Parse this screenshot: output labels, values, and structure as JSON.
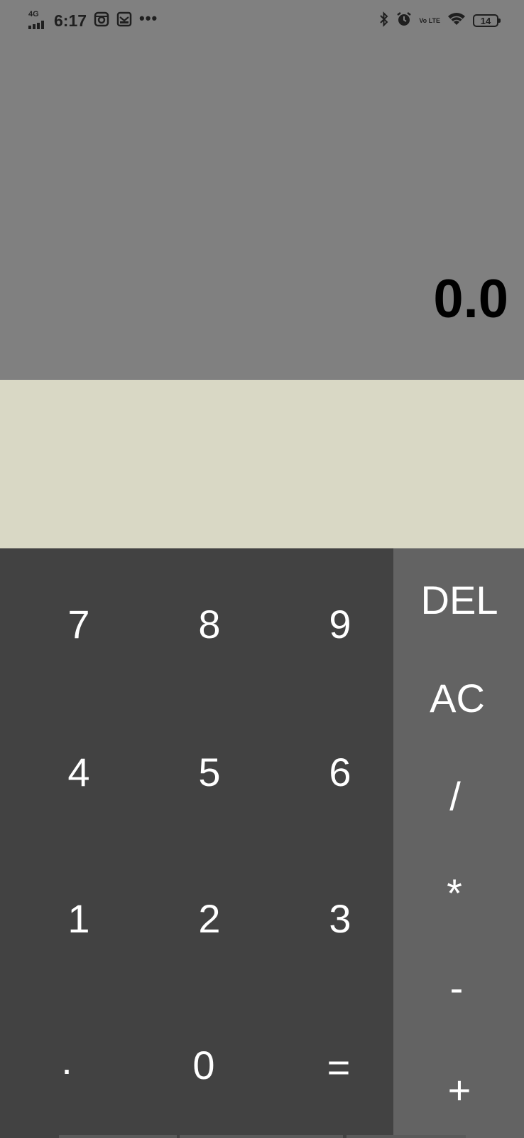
{
  "status_bar": {
    "network": "4G",
    "time": "6:17",
    "more": "•••",
    "volte": "Vo LTE",
    "battery": "14"
  },
  "display": {
    "result": "0.0"
  },
  "keypad": {
    "numbers": [
      "7",
      "8",
      "9",
      "4",
      "5",
      "6",
      "1",
      "2",
      "3",
      ".",
      "0",
      "="
    ],
    "operators": [
      "DEL",
      "AC",
      "/",
      "*",
      "-",
      "+"
    ]
  },
  "colors": {
    "display_bg": "#808080",
    "expression_bg": "#d9d8c5",
    "numpad_bg": "#424242",
    "oppad_bg": "#636363",
    "key_text": "#ffffff",
    "result_text": "#000000"
  }
}
